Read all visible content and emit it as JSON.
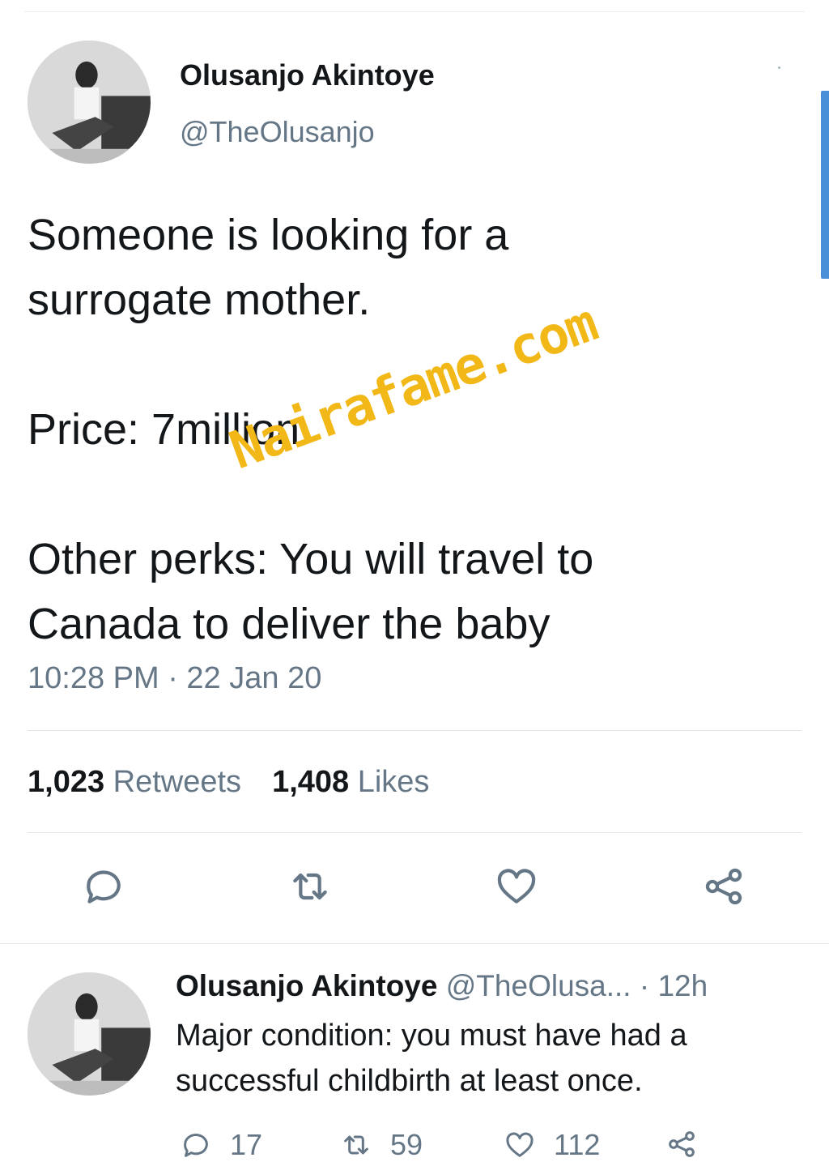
{
  "tweet": {
    "author_name": "Olusanjo Akintoye",
    "author_handle": "@TheOlusanjo",
    "lines": [
      "Someone is looking for a",
      "surrogate mother.",
      "Price: 7million",
      "Other perks: You will travel to",
      "Canada to deliver the baby"
    ],
    "time": "10:28 PM · 22 Jan 20",
    "retweets_count": "1,023",
    "retweets_label": "Retweets",
    "likes_count": "1,408",
    "likes_label": "Likes",
    "watermark": "Nairafame.com"
  },
  "reply": {
    "author_name": "Olusanjo Akintoye",
    "author_handle": "@TheOlusa...",
    "age": "· 12h",
    "text": "Major condition: you must have had a successful childbirth at least once.",
    "reply_count": "17",
    "retweet_count": "59",
    "like_count": "112"
  },
  "icons": {
    "reply": "reply-icon",
    "retweet": "retweet-icon",
    "like": "heart-icon",
    "share": "share-icon"
  },
  "colors": {
    "text_primary": "#14171a",
    "text_secondary": "#657786",
    "divider": "#e1e8ed",
    "watermark": "#f1b817",
    "scrollbar": "#4a90d9"
  }
}
